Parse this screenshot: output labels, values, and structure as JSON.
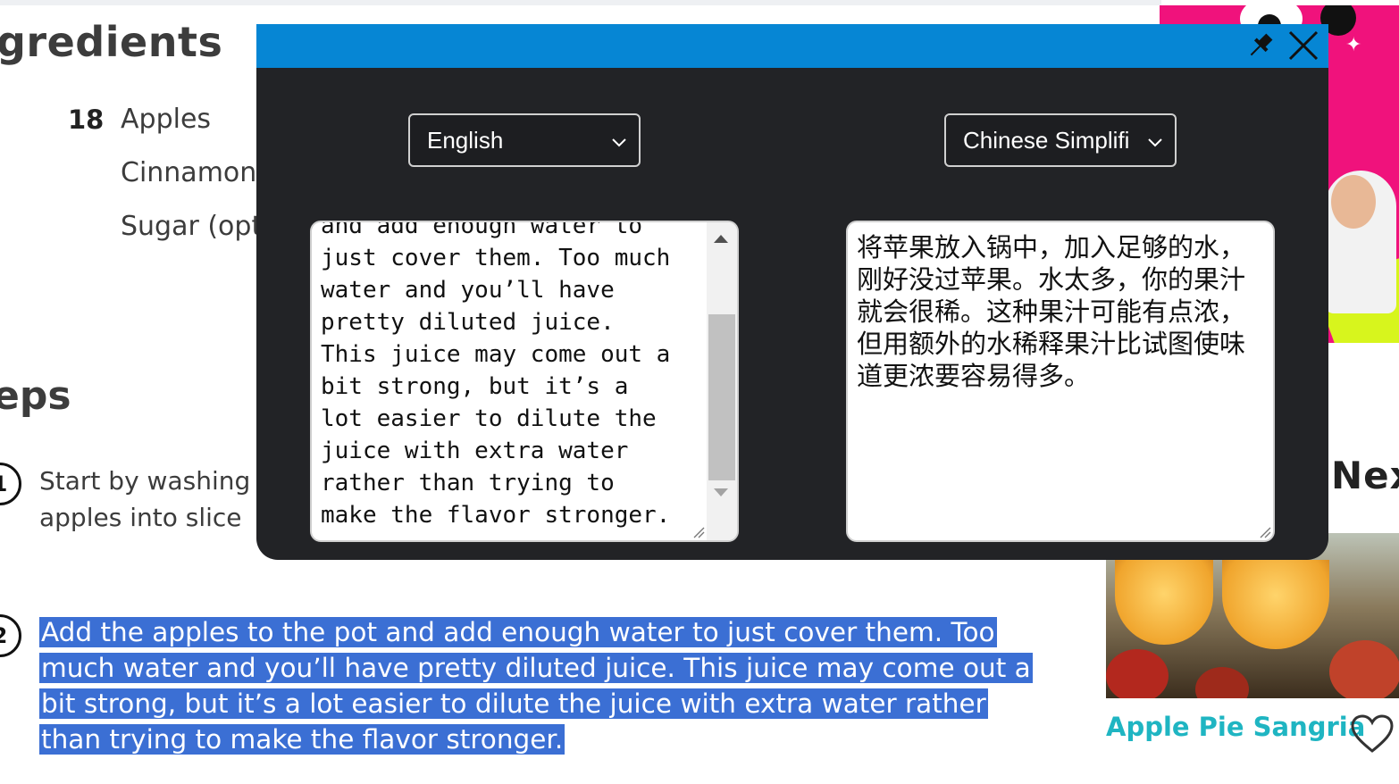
{
  "recipe": {
    "ingredients_heading": "gredients",
    "ingredients": [
      {
        "qty": "18",
        "name": "Apples"
      },
      {
        "qty": "",
        "name": "Cinnamon"
      },
      {
        "qty": "",
        "name": "Sugar (opt"
      }
    ],
    "steps_heading": "eps",
    "steps": [
      {
        "number": "1",
        "text": "Start by washing\napples into slice"
      },
      {
        "number": "2",
        "text": "Add the apples to the pot and add enough water to just cover them. Too much water and you’ll have pretty diluted juice. This juice may come out a bit strong, but it’s a lot easier to dilute the juice with extra water rather than trying to make the flavor stronger."
      }
    ],
    "selection_color": "#3b6fd4"
  },
  "sidebar": {
    "next_heading": "Next",
    "related_recipe_title": "Apple Pie Sangria",
    "title_color": "#1fb5c2",
    "banner_color": "#f0127c"
  },
  "translator": {
    "header_color": "#0686d4",
    "pin_icon": "pin-icon",
    "close_icon": "close-icon",
    "source_language": "English",
    "target_language": "Chinese Simplifi",
    "source_text": "and add enough water to\njust cover them. Too much\nwater and you’ll have\npretty diluted juice.\nThis juice may come out a\nbit strong, but it’s a\nlot easier to dilute the\njuice with extra water\nrather than trying to\nmake the flavor stronger.",
    "translated_text": "将苹果放入锅中，加入足够的水，刚好没过苹果。水太多，你的果汁就会很稀。这种果汁可能有点浓，但用额外的水稀释果汁比试图使味道更浓要容易得多。"
  }
}
